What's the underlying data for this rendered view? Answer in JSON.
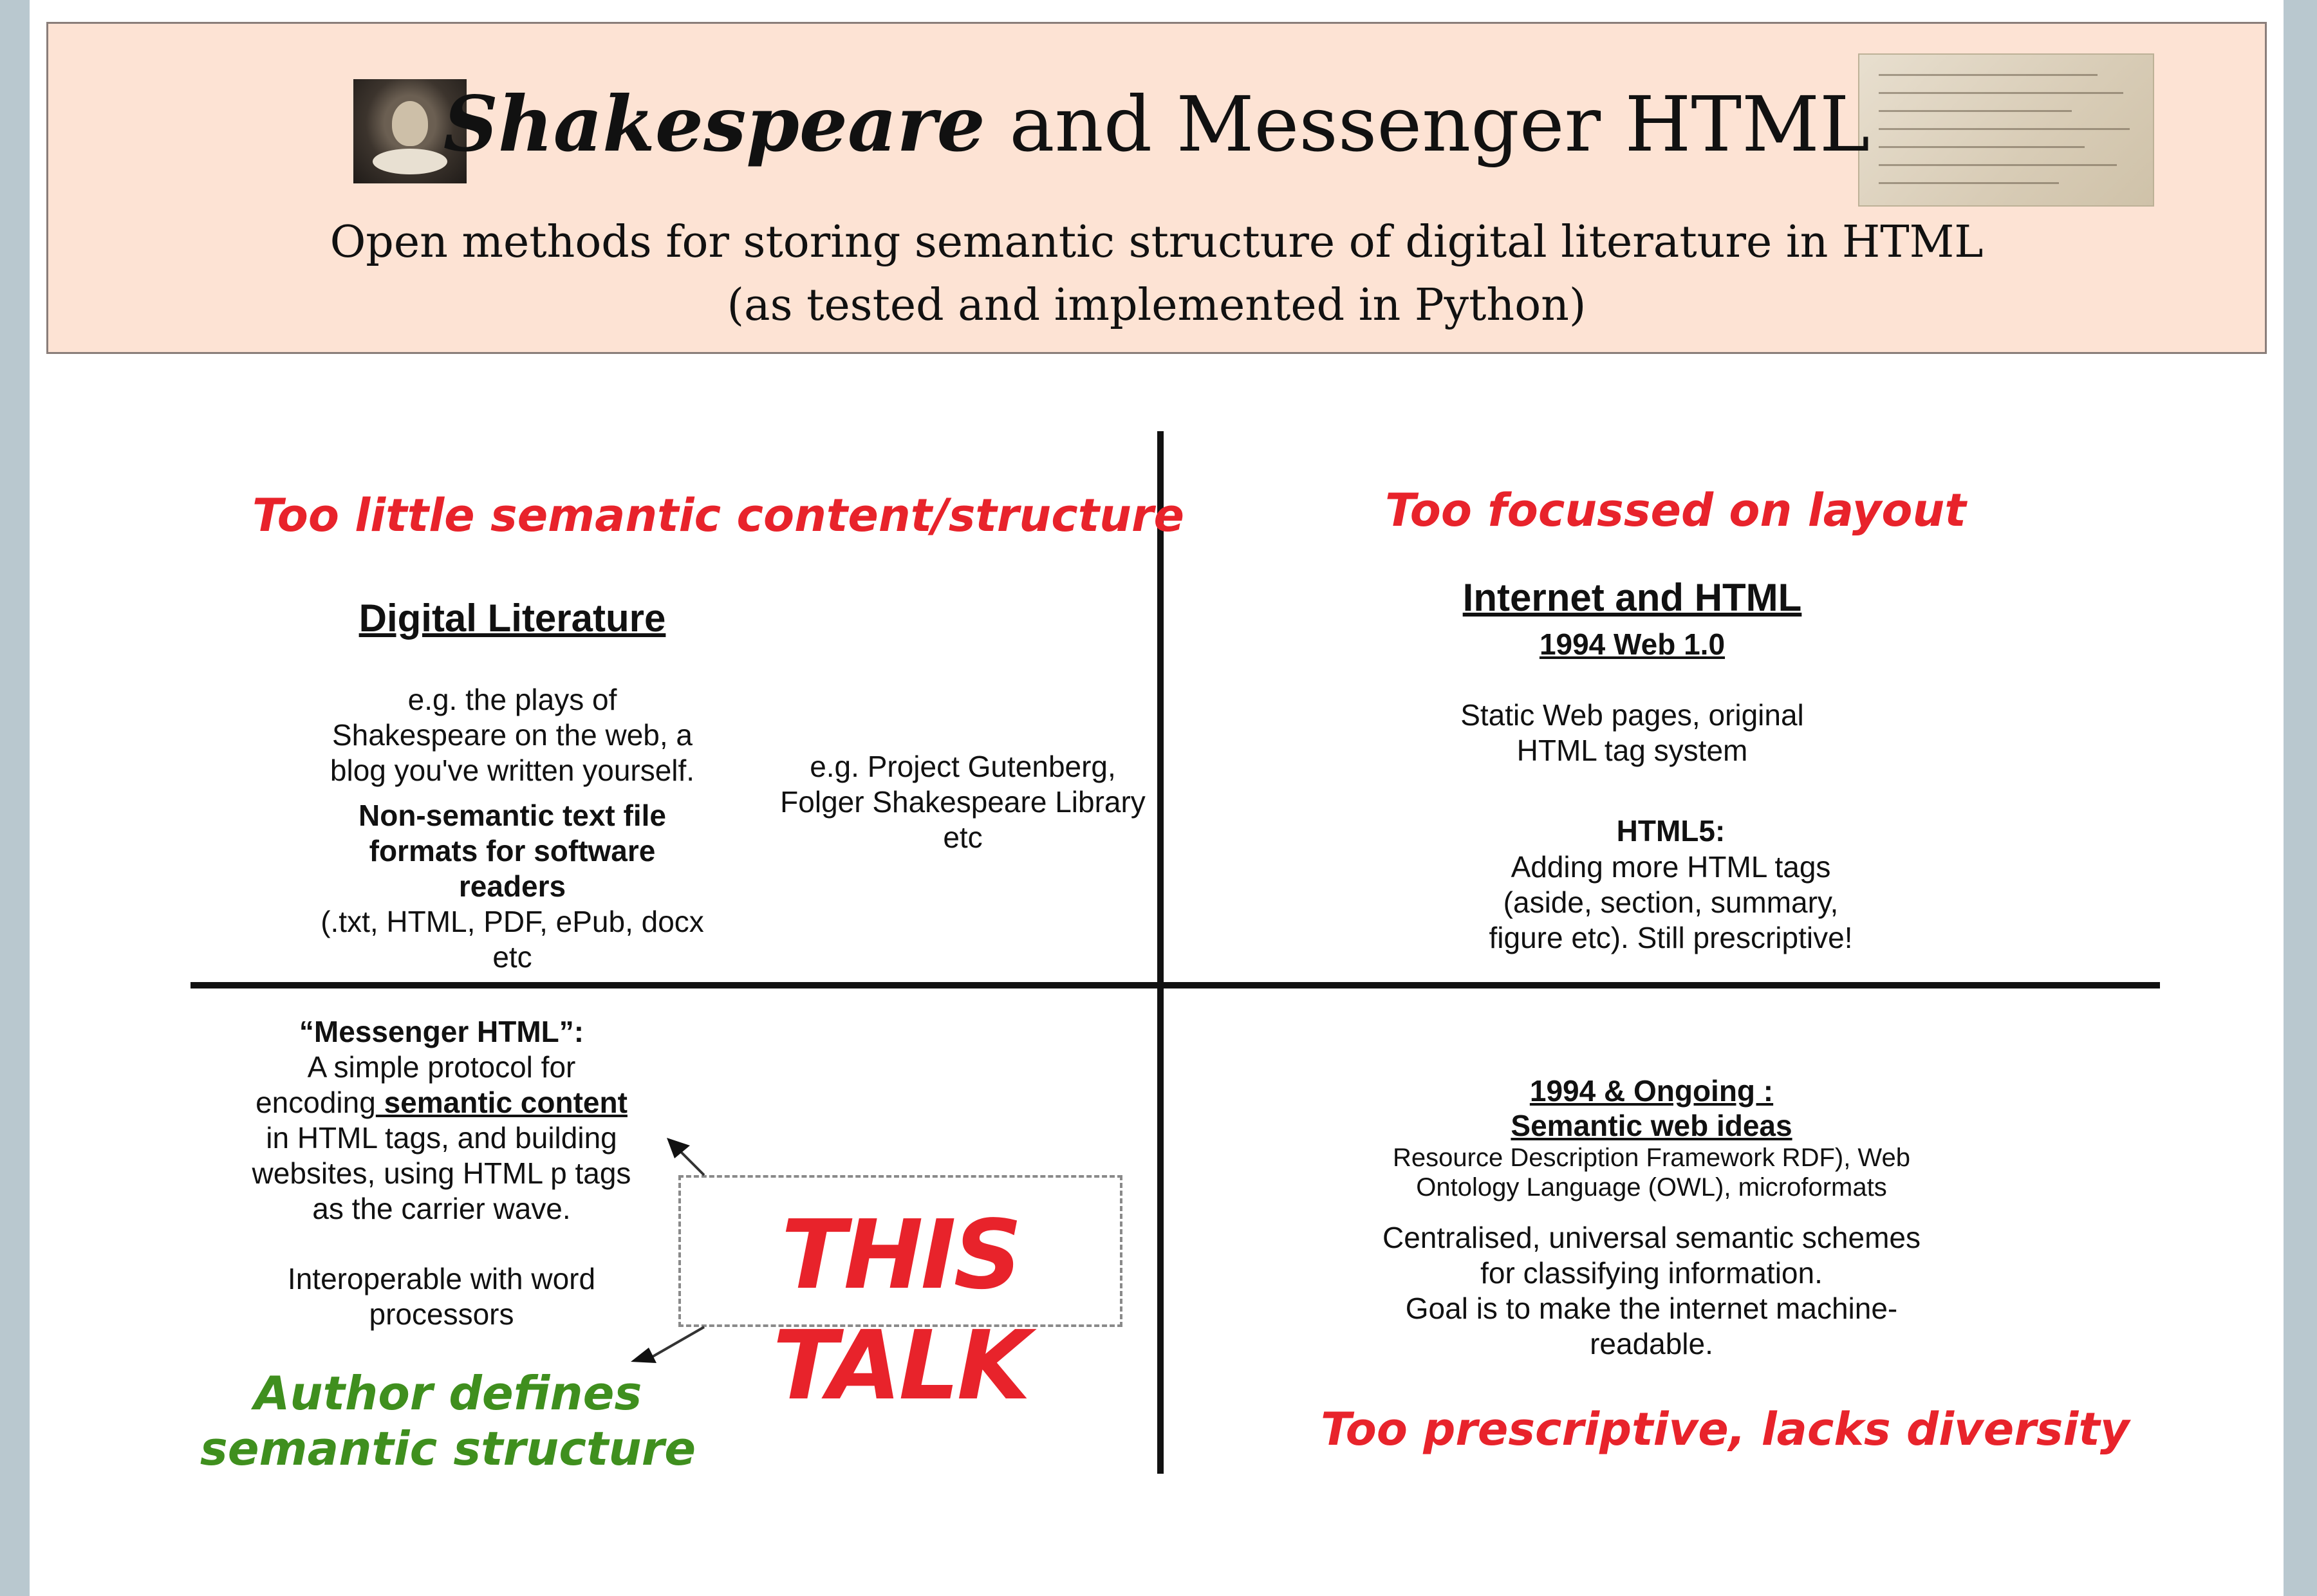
{
  "header": {
    "title_part1": "Shakespeare",
    "title_part2": " and Messenger HTML",
    "subtitle_line1": "Open methods for storing semantic structure of digital literature in HTML",
    "subtitle_line2": "(as tested and implemented in Python)"
  },
  "diagram": {
    "top_left": {
      "note": "Too little semantic content/structure",
      "heading": "Digital Literature",
      "example": [
        "e.g. the plays of",
        "Shakespeare on the web, a",
        "blog you've written yourself."
      ],
      "bold_desc": [
        "Non-semantic text file",
        "formats for software",
        "readers"
      ],
      "formats": [
        "(.txt, HTML, PDF, ePub, docx",
        "etc"
      ],
      "side_example": [
        "e.g. Project Gutenberg,",
        "Folger Shakespeare Library",
        "etc"
      ]
    },
    "top_right": {
      "note": "Too focussed on layout",
      "heading": "Internet and HTML",
      "subheading": "1994  Web 1.0",
      "static": [
        "Static Web pages, original",
        "HTML tag system"
      ],
      "html5_title": "HTML5:",
      "html5_desc": [
        "Adding more HTML tags",
        "(aside, section, summary,",
        "figure etc).  Still prescriptive!"
      ]
    },
    "bottom_left": {
      "messenger_title": "“Messenger HTML”:",
      "line1": "A simple protocol for",
      "line2_a": "encoding",
      "line2_b": " semantic content",
      "line3": "in HTML tags, and building",
      "line4": "websites, using HTML p tags",
      "line5": "as the carrier wave.",
      "interop": [
        "Interoperable with word",
        "processors"
      ],
      "note": [
        "Author defines",
        "semantic structure"
      ],
      "this_talk": "THIS TALK"
    },
    "bottom_right": {
      "heading1": "1994 & Ongoing :",
      "heading2": "Semantic web ideas",
      "small": [
        "Resource Description Framework RDF),  Web",
        "Ontology Language (OWL), microformats"
      ],
      "desc": [
        "Centralised, universal semantic schemes",
        "for classifying information.",
        "Goal is to make the internet machine-",
        "readable."
      ],
      "note": "Too prescriptive, lacks diversity"
    }
  },
  "colors": {
    "header_bg": "#fde3d4",
    "red_note": "#e8232b",
    "green_note": "#3f8f1e",
    "page_bg": "#b9c8cf"
  },
  "icons": {
    "portrait": "shakespeare-portrait-icon",
    "manuscript": "manuscript-image-icon"
  }
}
